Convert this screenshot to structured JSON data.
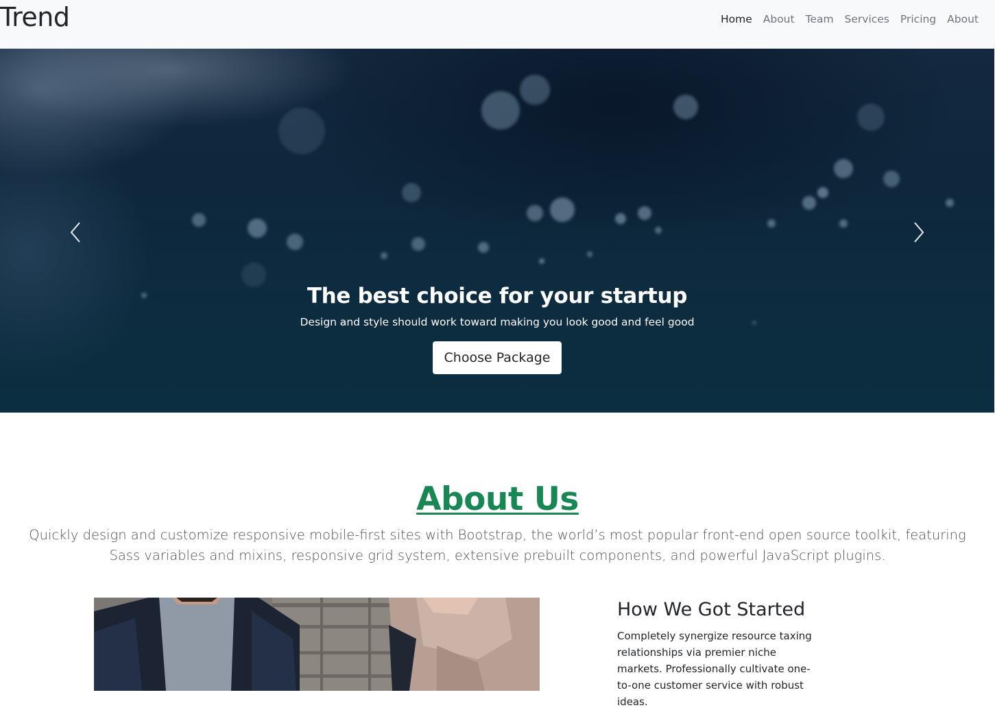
{
  "navbar": {
    "brand": "Trend",
    "links": [
      "Home",
      "About",
      "Team",
      "Services",
      "Pricing",
      "About"
    ],
    "active_index": 0
  },
  "hero": {
    "title": "The best choice for your startup",
    "subtitle": "Design and style should work toward making you look good and feel good",
    "cta_label": "Choose Package",
    "prev_icon": "chevron-left-icon",
    "next_icon": "chevron-right-icon"
  },
  "about": {
    "title": "About Us",
    "lead": "Quickly design and customize responsive mobile-first sites with Bootstrap, the world’s most popular front-end open source toolkit, featuring Sass variables and mixins, responsive grid system, extensive prebuilt components, and powerful JavaScript plugins.",
    "story_title": "How We Got Started",
    "story_text": "Completely synergize resource taxing relationships via premier niche markets. Professionally cultivate one-to-one customer service with robust ideas."
  },
  "colors": {
    "accent": "#198754",
    "navbar_bg": "#f8f9fa",
    "hero_bg": "#10344a"
  }
}
